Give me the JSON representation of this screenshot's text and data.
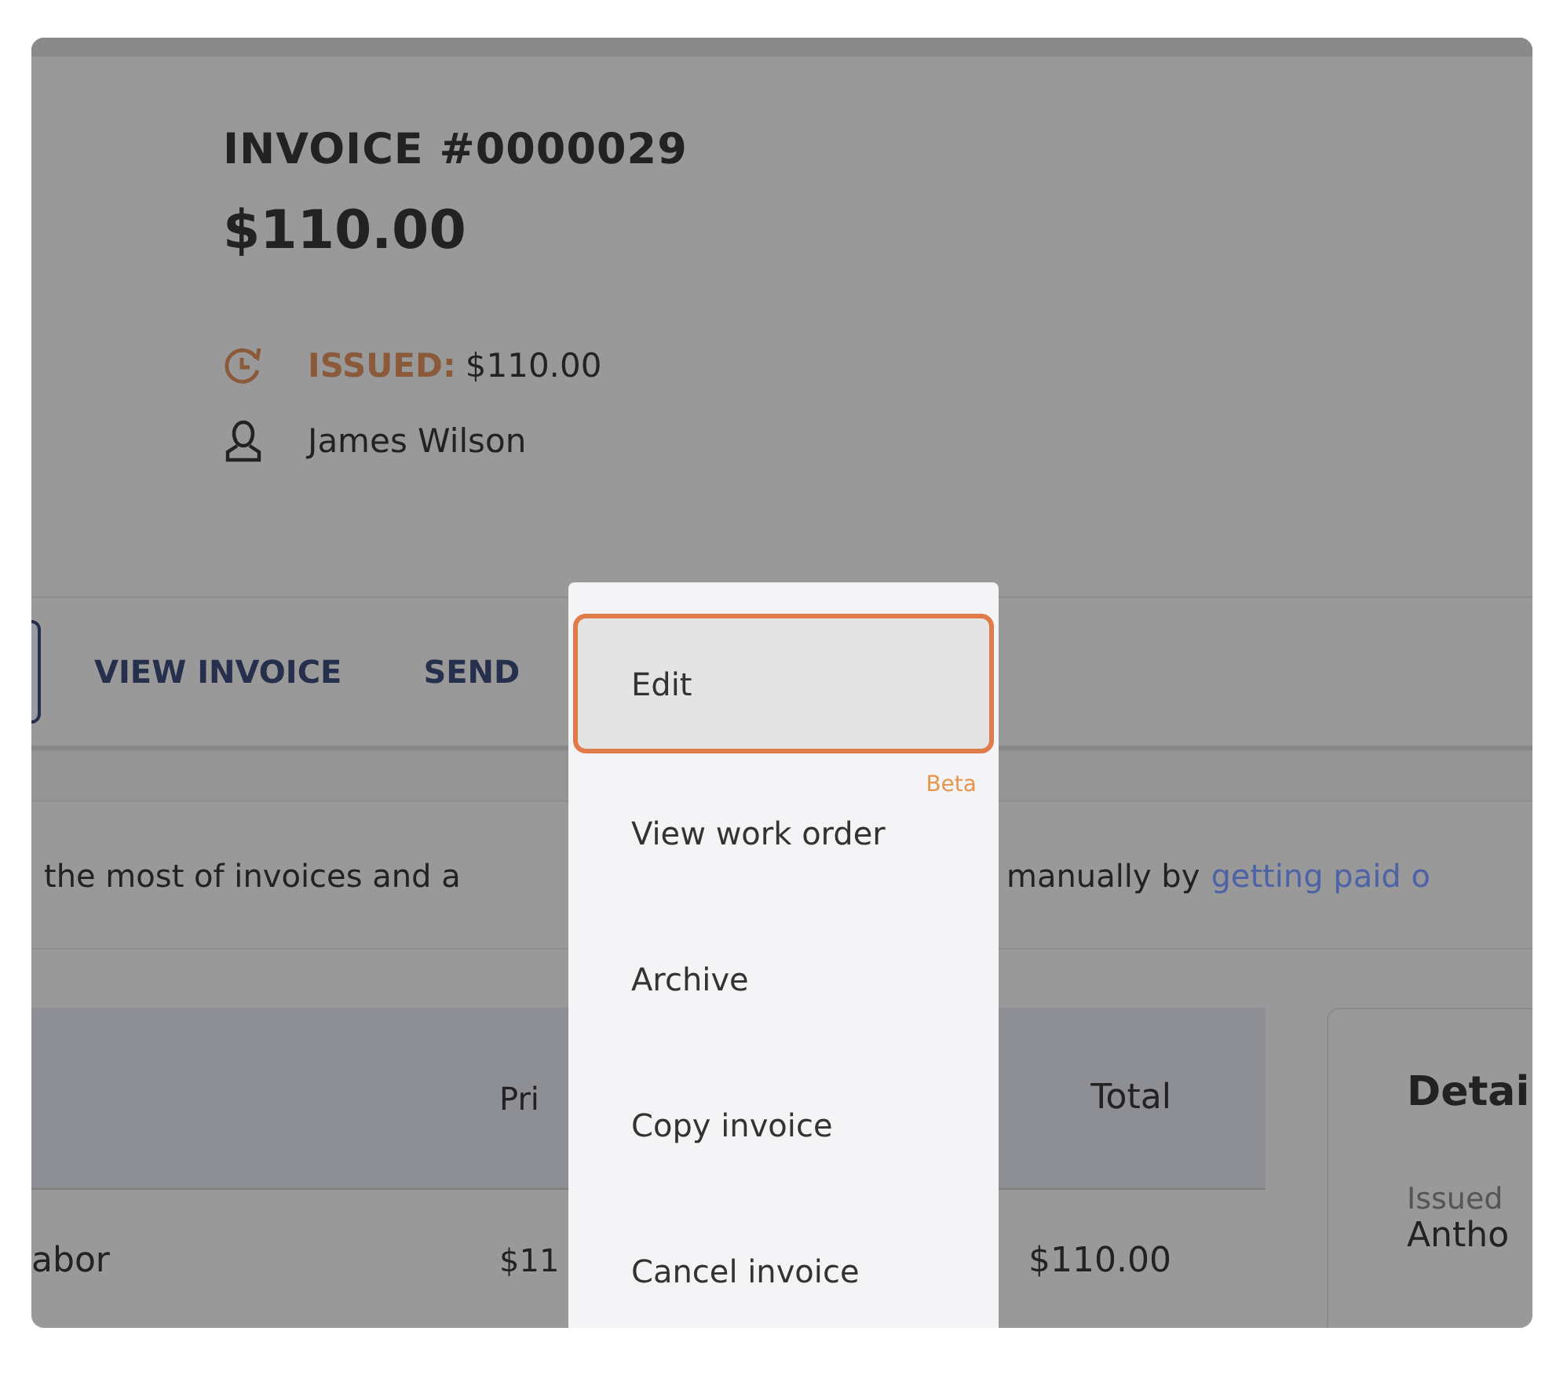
{
  "invoice": {
    "title": "INVOICE #0000029",
    "amount": "$110.00",
    "status": {
      "label": "ISSUED:",
      "value": "$110.00"
    },
    "customer": "James Wilson"
  },
  "actions": {
    "tabs": [
      {
        "label": "VIEW INVOICE"
      },
      {
        "label": "SEND"
      }
    ]
  },
  "banner": {
    "text": "the most of invoices and a",
    "text_2": "manually by",
    "link": "getting paid o"
  },
  "table": {
    "columns": [
      "Pri",
      "Total"
    ],
    "rows": [
      {
        "item": "abor",
        "price": "$11",
        "total": "$110.00"
      }
    ]
  },
  "details": {
    "title": "Detai",
    "label": "Issued",
    "value": "Antho"
  },
  "menu": {
    "items": [
      {
        "label": "Edit",
        "selected": true
      },
      {
        "label": "View work order",
        "selected": false,
        "badge": "Beta"
      },
      {
        "label": "Archive",
        "selected": false
      },
      {
        "label": "Copy invoice",
        "selected": false
      },
      {
        "label": "Cancel invoice",
        "selected": false
      }
    ]
  }
}
